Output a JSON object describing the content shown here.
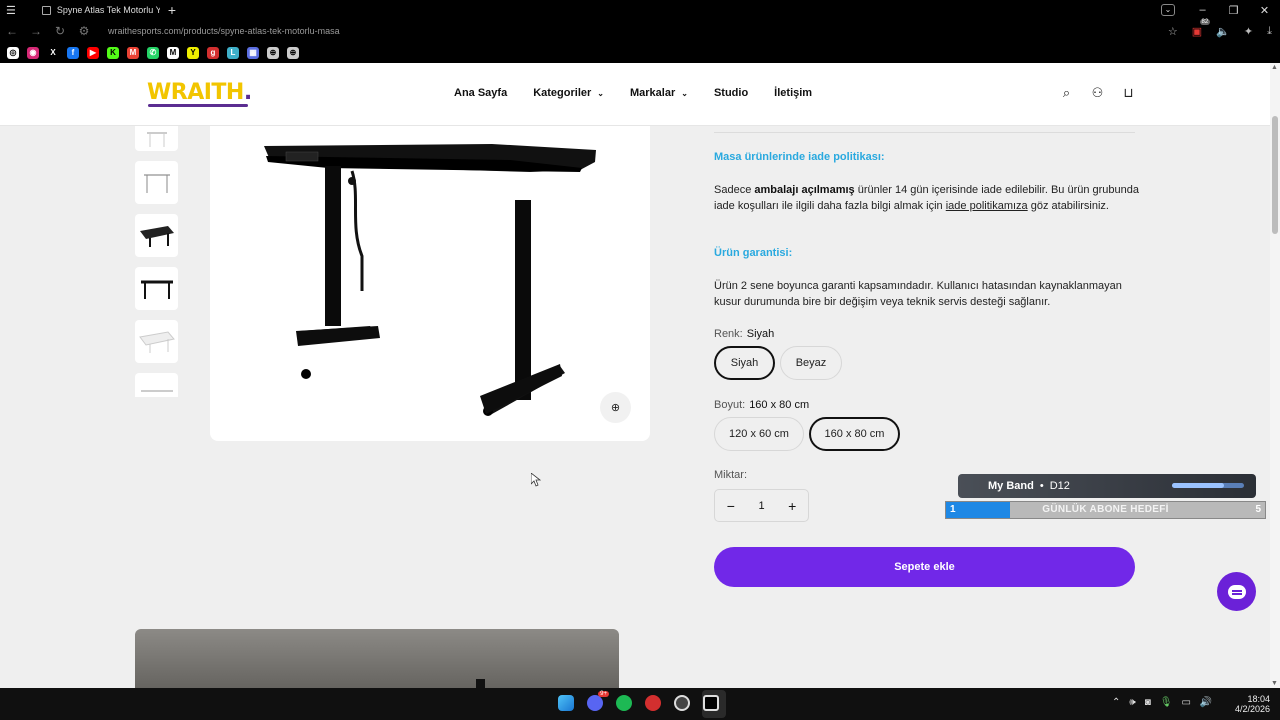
{
  "browser": {
    "tab_title": "Spyne Atlas Tek Motorlu Yü",
    "new_tab": "+",
    "url": "wraithesports.com/products/spyne-atlas-tek-motorlu-masa",
    "ext_badge": "82",
    "window_controls": [
      "–",
      "❐",
      "✕"
    ],
    "nav": [
      "←",
      "→",
      "↻"
    ]
  },
  "bookmarks": [
    {
      "icon": "chrome-icon",
      "color": "#ffffff",
      "glyph": "◎"
    },
    {
      "icon": "instagram-icon",
      "color": "#d62976",
      "glyph": "◉"
    },
    {
      "icon": "x-icon",
      "color": "#000000",
      "glyph": "X"
    },
    {
      "icon": "facebook-icon",
      "color": "#1877f2",
      "glyph": "f"
    },
    {
      "icon": "youtube-icon",
      "color": "#ff0000",
      "glyph": "▶"
    },
    {
      "icon": "kick-icon",
      "color": "#53fc18",
      "glyph": "K"
    },
    {
      "icon": "gmail-icon",
      "color": "#ea4335",
      "glyph": "M"
    },
    {
      "icon": "whatsapp-icon",
      "color": "#25d366",
      "glyph": "✆"
    },
    {
      "icon": "bookmark-m-icon",
      "color": "#ffffff",
      "glyph": "M"
    },
    {
      "icon": "yahoo-icon",
      "color": "#f0f000",
      "glyph": "Y"
    },
    {
      "icon": "bookmark-gp-icon",
      "color": "#d32f2f",
      "glyph": "g"
    },
    {
      "icon": "bookmark-l-icon",
      "color": "#3fb0c9",
      "glyph": "L"
    },
    {
      "icon": "bookmark-grid-icon",
      "color": "#5b6ee1",
      "glyph": "▦"
    },
    {
      "icon": "globe-icon",
      "color": "#cccccc",
      "glyph": "⊕"
    },
    {
      "icon": "globe-icon-2",
      "color": "#cccccc",
      "glyph": "⊕"
    }
  ],
  "site": {
    "logo": "WRAITH",
    "logo_dot": ".",
    "menu": [
      {
        "label": "Ana Sayfa",
        "dropdown": false
      },
      {
        "label": "Kategoriler",
        "dropdown": true
      },
      {
        "label": "Markalar",
        "dropdown": true
      },
      {
        "label": "Studio",
        "dropdown": false
      },
      {
        "label": "İletişim",
        "dropdown": false
      }
    ],
    "chev": "⌄"
  },
  "product": {
    "return_heading": "Masa ürünlerinde iade politikası:",
    "return_text_1": "Sadece ",
    "return_bold": "ambalajı açılmamış",
    "return_text_2": " ürünler 14 gün içerisinde iade edilebilir. Bu ürün grubunda iade koşulları ile ilgili daha fazla bilgi almak için ",
    "return_link": "iade politikamıza",
    "return_text_3": " göz atabilirsiniz.",
    "warranty_heading": "Ürün garantisi:",
    "warranty_text": "Ürün 2 sene boyunca garanti kapsamındadır. Kullanıcı hatasından kaynaklanmayan kusur durumunda bire bir değişim veya teknik servis desteği sağlanır.",
    "color_label": "Renk:",
    "color_value": "Siyah",
    "colors": [
      "Siyah",
      "Beyaz"
    ],
    "size_label": "Boyut:",
    "size_value": "160 x 80 cm",
    "sizes": [
      "120 x 60 cm",
      "160 x 80 cm"
    ],
    "qty_label": "Miktar:",
    "qty_value": "1",
    "qty_minus": "−",
    "qty_plus": "+",
    "cart_button": "Sepete ekle",
    "accent": "#7128e8",
    "heading_color": "#29a9df"
  },
  "overlay": {
    "name": "My Band",
    "separator": "•",
    "code": "D12",
    "goal_current": "1",
    "goal_text": "GÜNLÜK ABONE HEDEFİ",
    "goal_max": "5",
    "goal_fraction": 0.2,
    "band_level": 0.72
  },
  "taskbar": {
    "time": "18:04",
    "date": "4/2/2026",
    "discord_badge": "9+"
  }
}
